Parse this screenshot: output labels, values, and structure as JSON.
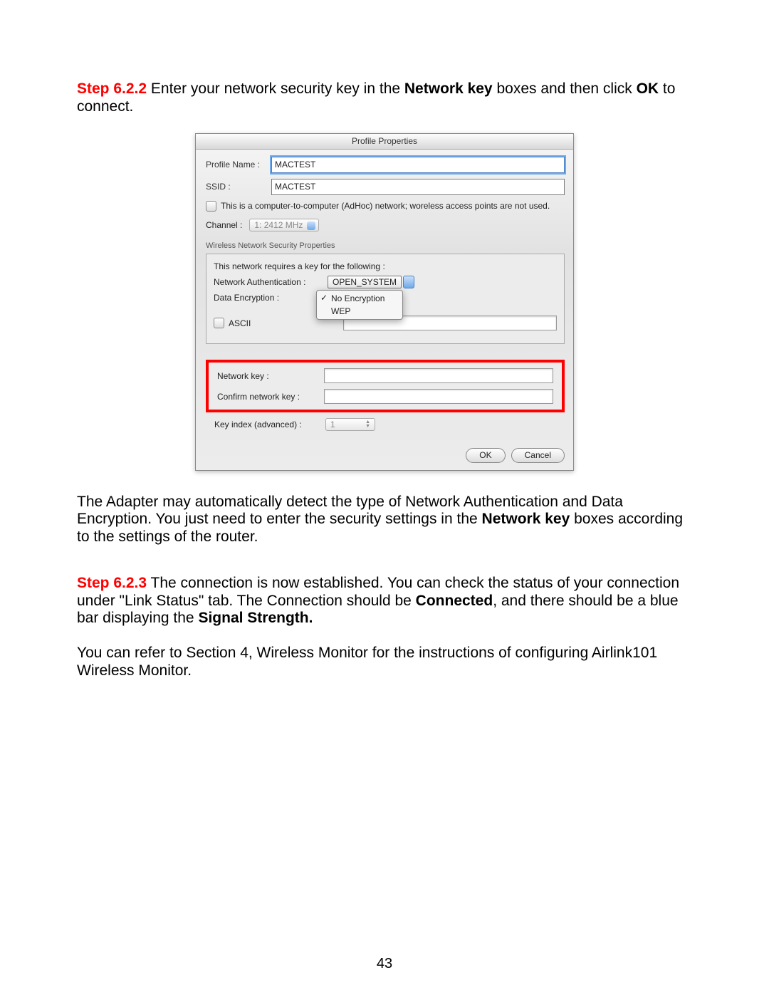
{
  "paragraphs": {
    "step622_label": "Step 6.2.2",
    "step622_text_a": " Enter your network security key in the ",
    "step622_bold_a": "Network key",
    "step622_text_b": " boxes and then click ",
    "step622_bold_b": "OK",
    "step622_text_c": " to connect.",
    "after_dialog_a": "The Adapter may automatically detect the type of Network Authentication and Data Encryption. You just need to enter the security settings in the ",
    "after_dialog_bold": "Network key",
    "after_dialog_b": " boxes according to the settings of the router.",
    "step623_label": "Step 6.2.3",
    "step623_text_a": " The connection is now established. You can check the status of your connection under \"Link Status\" tab. The Connection should be ",
    "step623_bold_a": "Connected",
    "step623_text_b": ", and there should be a blue bar displaying the ",
    "step623_bold_b": "Signal Strength.",
    "final": "You can refer to Section 4, Wireless Monitor for the instructions of configuring Airlink101 Wireless Monitor."
  },
  "dialog": {
    "title": "Profile Properties",
    "profile_name_label": "Profile Name :",
    "profile_name_value": "MACTEST",
    "ssid_label": "SSID :",
    "ssid_value": "MACTEST",
    "adhoc_text": "This is a computer-to-computer (AdHoc) network; woreless access points are not used.",
    "channel_label": "Channel :",
    "channel_value": "1: 2412 MHz",
    "security_section": "Wireless Network Security Properties",
    "requires_key": "This network requires a key for the following :",
    "network_auth_label": "Network Authentication :",
    "network_auth_value": "OPEN_SYSTEM",
    "data_encryption_label": "Data Encryption :",
    "enc_options": {
      "no_enc": "No Encryption",
      "wep": "WEP"
    },
    "ascii_label": "ASCII",
    "network_key_label": "Network key :",
    "confirm_key_label": "Confirm network key :",
    "key_index_label": "Key index (advanced) :",
    "key_index_value": "1",
    "ok": "OK",
    "cancel": "Cancel"
  },
  "page_number": "43"
}
